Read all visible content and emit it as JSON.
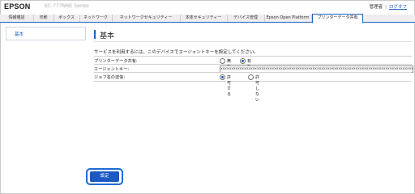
{
  "header": {
    "logo": "EPSON",
    "model": "EC-777NNE Series",
    "admin_label": "管理者",
    "separator": "|",
    "logout_label": "ログオフ"
  },
  "tabs": [
    {
      "label": "情報確認"
    },
    {
      "label": "印刷"
    },
    {
      "label": "ボックス"
    },
    {
      "label": "ネットワーク"
    },
    {
      "label": "ネットワークセキュリティー"
    },
    {
      "label": "本体セキュリティー"
    },
    {
      "label": "デバイス管理"
    },
    {
      "label": "Epson Open Platform"
    },
    {
      "label": "プリンターデータ共有",
      "active": true
    }
  ],
  "sidebar": {
    "items": [
      {
        "label": "基本"
      }
    ]
  },
  "page": {
    "title": "基本",
    "description": "サービスを利用するには、このデバイスでエージェントキーを設定してください。"
  },
  "settings": {
    "printer_data_sharing": {
      "label": "プリンターデータ共有:",
      "options": [
        "無効",
        "有効"
      ],
      "selected": "有効"
    },
    "agent_key": {
      "label": "エージェントキー:",
      "value": "xxxxxxxxxxxxxxxxxxxxxxxxxxxxxxxxxxxxxxxxxxxxxxxxxxxxxxxxxxxxxxxxxxxxxxxxxxxxxxxxxxxxxxxxxxxxxxxxxxxxxxxxxxxx"
    },
    "job_history": {
      "label": "ジョブ名の送信:",
      "options": [
        "許可する",
        "許可しない"
      ],
      "selected": "許可する"
    }
  },
  "footer": {
    "set_button": "設定"
  },
  "colors": {
    "accent": "#1e5fc5",
    "button": "#1c59c4",
    "link": "#1a5cc8"
  }
}
